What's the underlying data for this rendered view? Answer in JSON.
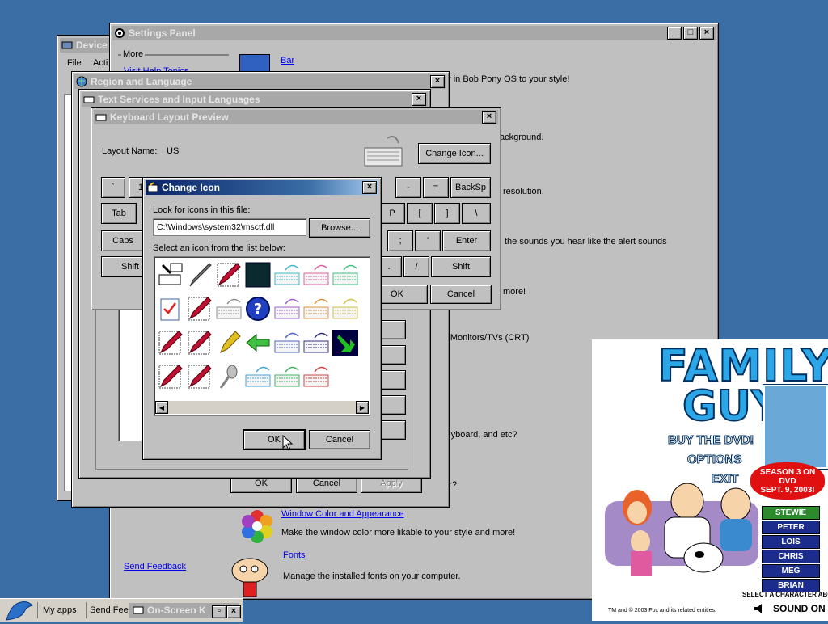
{
  "desktop_bg": "#3a6ea5",
  "device_window": {
    "title": "Device",
    "menu_file": "File",
    "menu_action": "Acti"
  },
  "settings_panel": {
    "title": "Settings Panel",
    "sidebar_more": "More",
    "sidebar_help": "Visit Help Topics",
    "send_feedback": "Send Feedback",
    "bar_link": "Bar",
    "lines": [
      "r in Bob Pony OS to your style!",
      "ackground.",
      "resolution.",
      "the sounds you hear like the alert sounds",
      "more!",
      "er Monitors/TVs (CRT)",
      "keyboard, and etc?",
      "uter?"
    ],
    "window_color_link": "Window Color and Appearance",
    "window_color_desc": "Make the window color more likable to your style and more!",
    "fonts_link": "Fonts",
    "fonts_desc": "Manage the installed fonts on your computer."
  },
  "region_window": {
    "title": "Region and Language",
    "ok": "OK",
    "cancel": "Cancel",
    "apply": "Apply"
  },
  "text_services_window": {
    "title": "Text Services and Input Languages"
  },
  "keyboard_preview": {
    "title": "Keyboard Layout Preview",
    "layout_label": "Layout Name:",
    "layout_value": "US",
    "change_icon_btn": "Change Icon...",
    "keys_row1": [
      "`",
      "1",
      "-",
      "=",
      "BackSp"
    ],
    "keys_row2": [
      "Tab",
      "P",
      "[",
      "]",
      "\\"
    ],
    "keys_row3": [
      "Caps",
      ";",
      "'",
      "Enter"
    ],
    "keys_row4": [
      "Shift",
      ".",
      "/",
      "Shift"
    ],
    "ok": "OK",
    "cancel": "Cancel"
  },
  "change_icon": {
    "title": "Change Icon",
    "look_label": "Look for icons in this file:",
    "file_path": "C:\\Windows\\system32\\msctf.dll",
    "browse": "Browse...",
    "select_label": "Select an icon from the list below:",
    "ok": "OK",
    "cancel": "Cancel",
    "icons": [
      "keyboard-pen-icon",
      "pen-icon",
      "pen-ji-icon",
      "dark-square-icon",
      "keyboard-cyan-icon",
      "keyboard-pink-icon",
      "keyboard-green-icon",
      "clipboard-check-icon",
      "pen-a-icon",
      "keyboard-gray-icon",
      "help-icon",
      "keyboard-purple-icon",
      "keyboard-orange-icon",
      "keyboard-yellow-icon",
      "pen-doc-icon",
      "pen-a2-icon",
      "pencil-icon",
      "back-arrow-icon",
      "keyboard-blue-icon",
      "keyboard-navy-icon",
      "green-arrow-icon",
      "red-pen-icon",
      "pen-ji2-icon",
      "microphone-icon",
      "keyboard-cyan2-icon",
      "keyboard-green2-icon",
      "keyboard-red-icon"
    ]
  },
  "ad": {
    "logo_line1": "FAMILY",
    "logo_line2": "GUY",
    "buy": "BUY THE DVD!",
    "options": "OPTIONS",
    "exit": "EXIT",
    "season": "SEASON 3 ON DVD",
    "date": "SEPT. 9, 2003!",
    "characters": [
      "STEWIE",
      "PETER",
      "LOIS",
      "CHRIS",
      "MEG",
      "BRIAN"
    ],
    "select_text": "SELECT A CHARACTER ABOVE",
    "tm": "TM and © 2003 Fox and its related entities.",
    "sound": "SOUND ON"
  },
  "taskbar": {
    "items": [
      "My apps",
      "Send Feed",
      "On-Screen K"
    ]
  }
}
